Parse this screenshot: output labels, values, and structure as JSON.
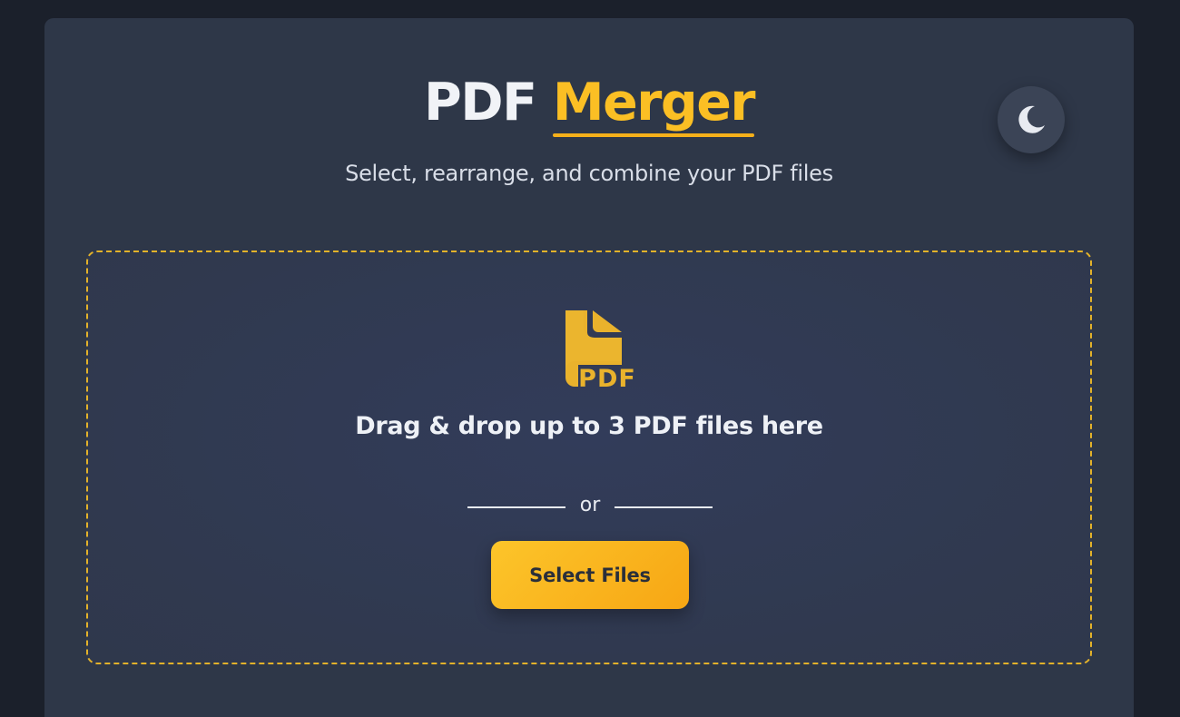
{
  "header": {
    "title_main": "PDF",
    "title_accent": "Merger",
    "subtitle": "Select, rearrange, and combine your PDF files"
  },
  "theme_toggle": {
    "icon": "moon-icon"
  },
  "dropzone": {
    "icon": "pdf-file-icon",
    "icon_label": "PDF",
    "prompt": "Drag & drop up to 3 PDF files here",
    "divider_text": "or",
    "button_label": "Select Files"
  },
  "colors": {
    "background": "#1b202b",
    "card": "#2e3748",
    "accent": "#fbbf24",
    "dropzone_border": "#e3b22a",
    "button_gradient_start": "#fcc52a",
    "button_gradient_end": "#f7a614"
  }
}
